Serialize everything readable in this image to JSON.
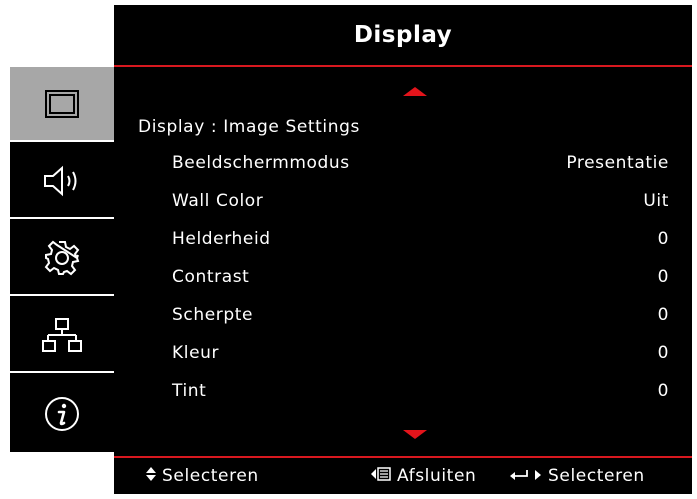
{
  "title": "Display",
  "section_title": "Display : Image Settings",
  "settings": [
    {
      "label": "Beeldschermmodus",
      "value": "Presentatie"
    },
    {
      "label": "Wall Color",
      "value": "Uit"
    },
    {
      "label": "Helderheid",
      "value": "0"
    },
    {
      "label": "Contrast",
      "value": "0"
    },
    {
      "label": "Scherpte",
      "value": "0"
    },
    {
      "label": "Kleur",
      "value": "0"
    },
    {
      "label": "Tint",
      "value": "0"
    }
  ],
  "footer": {
    "select_updown_label": "Selecteren",
    "exit_label": "Afsluiten",
    "enter_select_label": "Selecteren",
    "updown_icon": "up-down-arrows-icon",
    "exit_icon": "menu-back-icon",
    "enter_icon": "enter-arrow-icon"
  },
  "sidebar": {
    "items": [
      {
        "name": "display",
        "icon": "display-icon",
        "active": true
      },
      {
        "name": "audio",
        "icon": "speaker-icon",
        "active": false
      },
      {
        "name": "setup",
        "icon": "gear-icon",
        "active": false
      },
      {
        "name": "network",
        "icon": "network-icon",
        "active": false
      },
      {
        "name": "info",
        "icon": "info-icon",
        "active": false
      }
    ]
  },
  "colors": {
    "accent": "#e3141b",
    "background": "#000000",
    "active_tab": "#a7a7a7",
    "text": "#ffffff"
  }
}
